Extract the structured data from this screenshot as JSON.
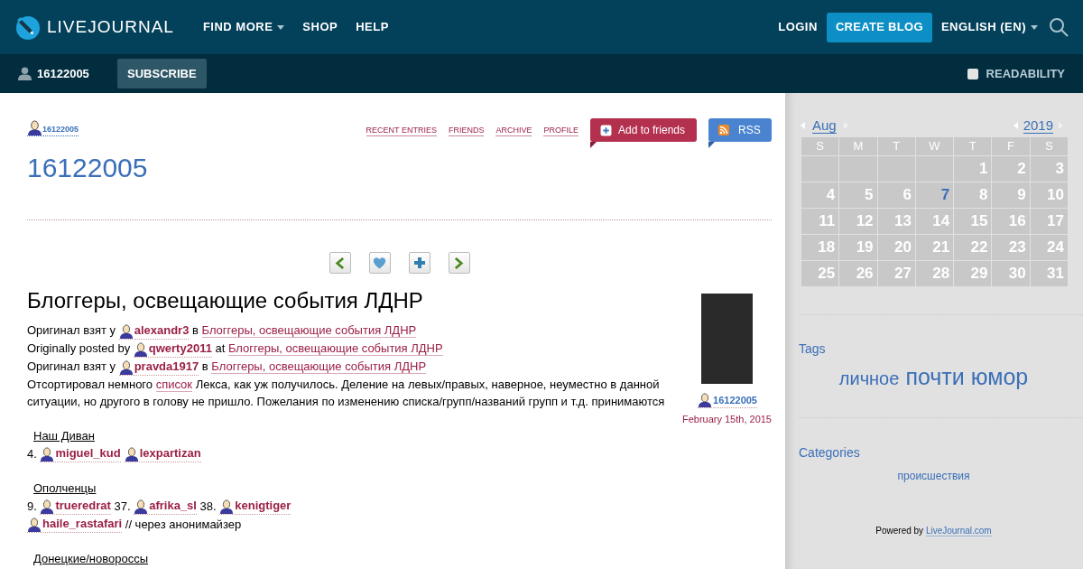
{
  "header": {
    "logo": "LIVEJOURNAL",
    "nav": [
      {
        "label": "FIND MORE",
        "dropdown": true
      },
      {
        "label": "SHOP",
        "dropdown": false
      },
      {
        "label": "HELP",
        "dropdown": false
      }
    ],
    "login": "LOGIN",
    "create": "CREATE BLOG",
    "language": "ENGLISH (EN)"
  },
  "subheader": {
    "user": "16122005",
    "subscribe": "SUBSCRIBE",
    "readability": {
      "label": "READABILITY",
      "checked": false
    }
  },
  "journal": {
    "user": "16122005",
    "links": [
      "RECENT ENTRIES",
      "FRIENDS",
      "ARCHIVE",
      "PROFILE"
    ],
    "add_friends": "Add to friends",
    "rss": "RSS",
    "title": "16122005"
  },
  "entry": {
    "title": "Блоггеры, освещающие события ЛДНР",
    "author": "16122005",
    "date": "February 15th, 2015",
    "blocks": [
      {
        "kind": "line",
        "segments": [
          {
            "kind": "text",
            "text": "Оригинал взят у "
          },
          {
            "kind": "user",
            "text": "alexandr3"
          },
          {
            "kind": "text",
            "text": " в "
          },
          {
            "kind": "link",
            "text": "Блоггеры, освещающие события ЛДНР"
          }
        ]
      },
      {
        "kind": "line",
        "segments": [
          {
            "kind": "text",
            "text": "Originally posted by "
          },
          {
            "kind": "user",
            "text": "qwerty2011"
          },
          {
            "kind": "text",
            "text": " at "
          },
          {
            "kind": "link",
            "text": "Блоггеры, освещающие события ЛДНР"
          }
        ]
      },
      {
        "kind": "line",
        "segments": [
          {
            "kind": "text",
            "text": "Оригинал взят у "
          },
          {
            "kind": "user",
            "text": "pravda1917"
          },
          {
            "kind": "text",
            "text": " в "
          },
          {
            "kind": "link",
            "text": "Блоггеры, освещающие события ЛДНР"
          }
        ]
      },
      {
        "kind": "line",
        "segments": [
          {
            "kind": "text",
            "text": "Отсортировал немного "
          },
          {
            "kind": "link",
            "text": "список"
          },
          {
            "kind": "text",
            "text": " Лекса, как уж получилось. Деление на левых/правых, наверное, неуместно в данной ситуации, но другого в голову не пришло. Пожелания по изменению списка/групп/названий групп и т.д. принимаются"
          }
        ]
      },
      {
        "kind": "heading",
        "text": "Наш Диван"
      },
      {
        "kind": "line",
        "segments": [
          {
            "kind": "text",
            "text": "4. "
          },
          {
            "kind": "user",
            "text": "miguel_kud"
          },
          {
            "kind": "user",
            "text": "lexpartizan"
          }
        ]
      },
      {
        "kind": "heading",
        "text": "Ополченцы"
      },
      {
        "kind": "line",
        "segments": [
          {
            "kind": "text",
            "text": "9. "
          },
          {
            "kind": "user",
            "text": "trueredrat"
          },
          {
            "kind": "text",
            "text": " 37. "
          },
          {
            "kind": "user",
            "text": "afrika_sl"
          },
          {
            "kind": "text",
            "text": " 38. "
          },
          {
            "kind": "user",
            "text": "kenigtiger"
          }
        ]
      },
      {
        "kind": "line",
        "segments": [
          {
            "kind": "user",
            "text": "haile_rastafari"
          },
          {
            "kind": "text",
            "text": " // через анонимайзер"
          }
        ]
      },
      {
        "kind": "heading",
        "text": "Донецкие/новороссы"
      }
    ]
  },
  "calendar": {
    "month": "Aug",
    "year": "2019",
    "weekdays": [
      "S",
      "M",
      "T",
      "W",
      "T",
      "F",
      "S"
    ],
    "weeks": [
      [
        {
          "kind": "blank"
        },
        {
          "kind": "blank"
        },
        {
          "kind": "blank"
        },
        {
          "kind": "blank"
        },
        {
          "kind": "day",
          "day": "1",
          "linked": false
        },
        {
          "kind": "day",
          "day": "2",
          "linked": false
        },
        {
          "kind": "day",
          "day": "3",
          "linked": false
        }
      ],
      [
        {
          "kind": "day",
          "day": "4",
          "linked": false
        },
        {
          "kind": "day",
          "day": "5",
          "linked": false
        },
        {
          "kind": "day",
          "day": "6",
          "linked": false
        },
        {
          "kind": "day",
          "day": "7",
          "linked": true
        },
        {
          "kind": "day",
          "day": "8",
          "linked": false
        },
        {
          "kind": "day",
          "day": "9",
          "linked": false
        },
        {
          "kind": "day",
          "day": "10",
          "linked": false
        }
      ],
      [
        {
          "kind": "day",
          "day": "11",
          "linked": false
        },
        {
          "kind": "day",
          "day": "12",
          "linked": false
        },
        {
          "kind": "day",
          "day": "13",
          "linked": false
        },
        {
          "kind": "day",
          "day": "14",
          "linked": false
        },
        {
          "kind": "day",
          "day": "15",
          "linked": false
        },
        {
          "kind": "day",
          "day": "16",
          "linked": false
        },
        {
          "kind": "day",
          "day": "17",
          "linked": false
        }
      ],
      [
        {
          "kind": "day",
          "day": "18",
          "linked": false
        },
        {
          "kind": "day",
          "day": "19",
          "linked": false
        },
        {
          "kind": "day",
          "day": "20",
          "linked": false
        },
        {
          "kind": "day",
          "day": "21",
          "linked": false
        },
        {
          "kind": "day",
          "day": "22",
          "linked": false
        },
        {
          "kind": "day",
          "day": "23",
          "linked": false
        },
        {
          "kind": "day",
          "day": "24",
          "linked": false
        }
      ],
      [
        {
          "kind": "day",
          "day": "25",
          "linked": false
        },
        {
          "kind": "day",
          "day": "26",
          "linked": false
        },
        {
          "kind": "day",
          "day": "27",
          "linked": false
        },
        {
          "kind": "day",
          "day": "28",
          "linked": false
        },
        {
          "kind": "day",
          "day": "29",
          "linked": false
        },
        {
          "kind": "day",
          "day": "30",
          "linked": false
        },
        {
          "kind": "day",
          "day": "31",
          "linked": false
        }
      ]
    ]
  },
  "tags": {
    "heading": "Tags",
    "items": [
      {
        "text": "личное",
        "kind": "small"
      },
      {
        "text": "почти",
        "kind": "large"
      },
      {
        "text": "юмор",
        "kind": "large"
      }
    ]
  },
  "categories": {
    "heading": "Categories",
    "items": [
      "происшествия"
    ]
  },
  "footer": {
    "prefix": "Powered by",
    "link": "LiveJournal.com"
  }
}
